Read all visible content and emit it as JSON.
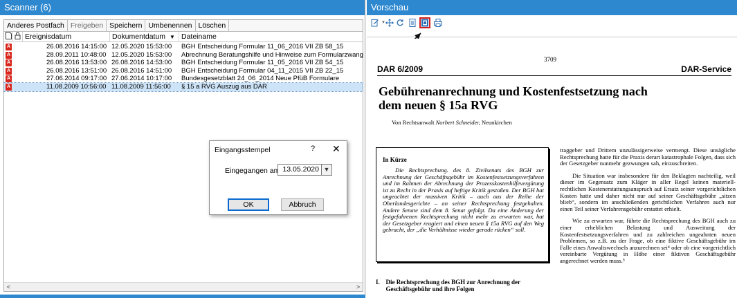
{
  "scanner": {
    "title": "Scanner (6)",
    "toolbar": {
      "other_mailbox": "Anderes Postfach",
      "release": "Freigeben",
      "save": "Speichern",
      "rename": "Umbenennen",
      "delete": "Löschen"
    },
    "columns": {
      "event_date": "Ereignisdatum",
      "doc_date": "Dokumentdatum",
      "filename": "Dateiname"
    },
    "rows": [
      {
        "event": "26.08.2016 14:15:00",
        "doc": "12.05.2020 15:53:00",
        "name": "BGH Entscheidung Formular 11_06_2016 VII ZB 58_15"
      },
      {
        "event": "28.09.2011 10:48:00",
        "doc": "12.05.2020 15:53:00",
        "name": "Abrechnung Beratungshilfe und Hinweise zum Formularzwang"
      },
      {
        "event": "26.08.2016 13:53:00",
        "doc": "26.08.2016 14:53:00",
        "name": "BGH Entscheidung Formular 11_05_2016 VII ZB 54_15"
      },
      {
        "event": "26.08.2016 13:51:00",
        "doc": "26.08.2016 14:51:00",
        "name": "BGH Entscheidung Formular 04_11_2015 VII ZB 22_15"
      },
      {
        "event": "27.06.2014 09:17:00",
        "doc": "27.06.2014 10:17:00",
        "name": "Bundesgesetzblatt 24_06_2014 Neue PfüB Formulare"
      },
      {
        "event": "11.08.2009 10:56:00",
        "doc": "11.08.2009 11:56:00",
        "name": "§ 15 a RVG Auszug aus DAR"
      }
    ],
    "selected_row": 5
  },
  "dialog": {
    "title": "Eingangsstempel",
    "help": "?",
    "close": "✕",
    "label": "Eingegangen am:",
    "date_value": "13.05.2020",
    "ok": "OK",
    "cancel": "Abbruch"
  },
  "preview": {
    "title": "Vorschau",
    "page_number": "3709",
    "header_left": "DAR 6/2009",
    "header_right": "DAR-Service",
    "doc_title": "Gebührenanrechnung und Kostenfestsetzung nach dem neuen § 15a RVG",
    "author_prefix": "Von Rechtsanwalt ",
    "author_name": "Norbert Schneider,",
    "author_suffix": " Neunkirchen",
    "box_heading": "In Kürze",
    "box_text": "Die Rechtsprechung. des 8. Zivilsenats des BGH zur Anrechnung der Geschäftsgebühr im Kostenfestsetzungsverfahren und im Rahmen der Abrechnung der Prozesskostenhilfevergütung ist zu Recht in der Praxis auf heftige Kritik gestoßen. Der BGH hat ungeachtet der massiven Kritik – auch aus der Reihe der Oberlandesgerichte – an seiner Rechtsprechung festgehalten. Andere Senate sind dem 8. Senat gefolgt. Da eine Änderung der festgefahrenen Rechtsprechung nicht mehr zu erwarten war, hat der Gesetzgeber reagiert und einen neuen § 15a RVG auf den Weg gebracht, der „die Verhältnisse wieder gerade rücken“ soll.",
    "section_num": "I.",
    "section_title": "Die Rechtsprechung des BGH zur Anrechnung der Geschäftsgebühr und ihre Folgen",
    "para1": "traggeber und Drittem unzulässigerweise vermengt. Diese unsägliche Rechtsprechung hatte für die Praxis derart katastrophale Folgen, dass sich der Gesetzgeber nunmehr gezwungen sah, einzuschreiten.",
    "para2": "Die Situation war insbesondere für den Beklagten nachteilig, weil dieser im Gegensatz zum Kläger in aller Regel keinen materiell-rechtlichen Kostenerstattungsanspruch auf Ersatz seiner vorgerichtlichen Kosten hatte und daher nicht nur auf seiner Geschäftsgebühr „sitzen blieb“, sondern im anschließenden gerichtlichen Verfahren auch nur einen Teil seiner Verfahrensgebühr erstattet erhielt.",
    "para3": "Wie zu erwarten war, führte die Rechtsprechung des BGH auch zu einer erheblichen Belastung und Ausweitung der Kostenfestsetzungsverfahren und zu zahlreichen ungeahnten neuen Problemen, so z.B. zu der Frage, ob eine fiktive Geschäftsgebühr im Falle eines Anwaltswechsels anzurechnen sei⁴ oder ob eine vorgerichtlich vereinbarte Vergütung in Höhe einer fiktiven Geschäftsgebühr angerechnet werden muss.⁵"
  }
}
